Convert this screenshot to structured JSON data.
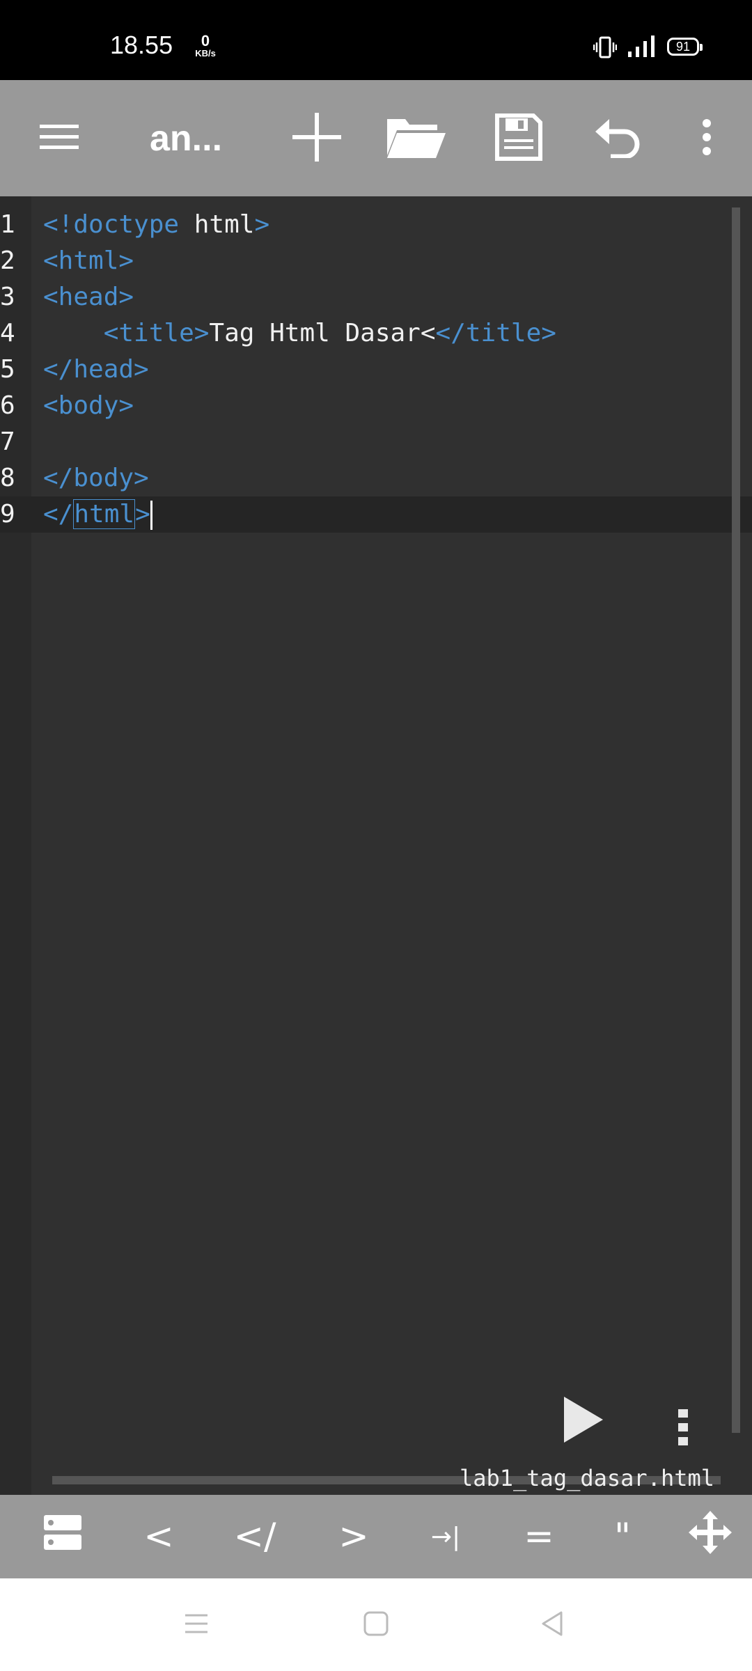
{
  "status_bar": {
    "time": "18.55",
    "net_speed": "0",
    "net_unit": "KB/s",
    "battery": "91"
  },
  "toolbar": {
    "title": "an...",
    "icons": [
      "menu-icon",
      "add-icon",
      "folder-icon",
      "save-icon",
      "undo-icon",
      "more-vert-icon"
    ],
    "bg_color": "#999999"
  },
  "editor": {
    "lines": [
      {
        "num": "1",
        "parts": [
          {
            "t": "<!doctype",
            "tag": true
          },
          {
            "t": " html",
            "tag": false
          },
          {
            "t": ">",
            "tag": true
          }
        ]
      },
      {
        "num": "2",
        "parts": [
          {
            "t": "<html>",
            "tag": true
          }
        ]
      },
      {
        "num": "3",
        "parts": [
          {
            "t": "<head>",
            "tag": true
          }
        ]
      },
      {
        "num": "4",
        "parts": [
          {
            "t": "    ",
            "tag": false
          },
          {
            "t": "<title>",
            "tag": true
          },
          {
            "t": "Tag Html Dasar<",
            "tag": false
          },
          {
            "t": "</title>",
            "tag": true
          }
        ]
      },
      {
        "num": "5",
        "parts": [
          {
            "t": "</head>",
            "tag": true
          }
        ]
      },
      {
        "num": "6",
        "parts": [
          {
            "t": "<body>",
            "tag": true
          }
        ]
      },
      {
        "num": "7",
        "parts": []
      },
      {
        "num": "8",
        "parts": [
          {
            "t": "</body>",
            "tag": true
          }
        ]
      },
      {
        "num": "9",
        "parts": [
          {
            "t": "</",
            "tag": true
          },
          {
            "t": "html",
            "tag": true,
            "box": true
          },
          {
            "t": ">",
            "tag": true
          }
        ],
        "active": true,
        "caret": true
      }
    ],
    "tag_color": "#4a90d0",
    "text_color": "#f0f0f0",
    "filename": "lab1_tag_dasar.html"
  },
  "keybar": {
    "keys": [
      {
        "label": "",
        "name": "toggle-panel-key"
      },
      {
        "label": "<",
        "name": "key-lt"
      },
      {
        "label": "</",
        "name": "key-close-tag"
      },
      {
        "label": ">",
        "name": "key-gt"
      },
      {
        "label": "→|",
        "name": "key-tab"
      },
      {
        "label": "=",
        "name": "key-equals"
      },
      {
        "label": "\"",
        "name": "key-quote"
      },
      {
        "label": "",
        "name": "move-key"
      }
    ]
  }
}
